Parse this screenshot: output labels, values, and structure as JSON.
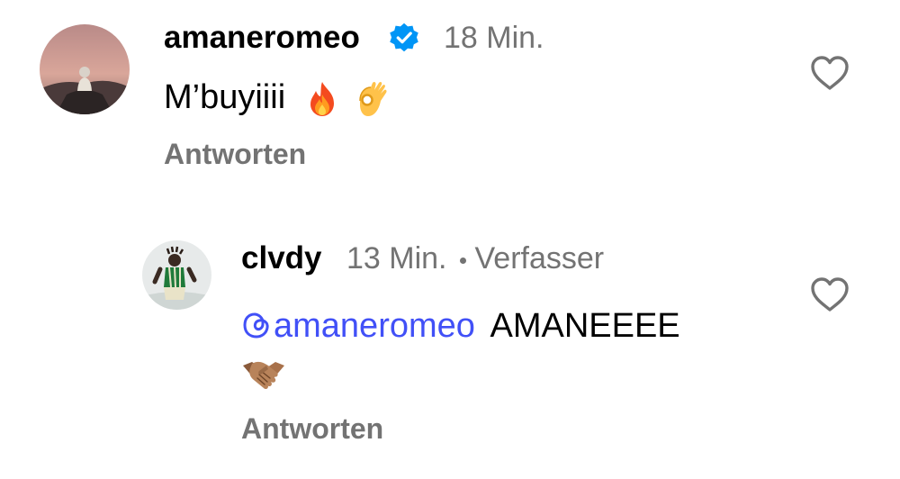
{
  "comment": {
    "username": "amaneromeo",
    "verified": true,
    "time": "18 Min.",
    "text": "M’buyiiii",
    "emojis": [
      "fire-emoji",
      "ok-hand-emoji"
    ],
    "reply_label": "Antworten",
    "like_icon": "heart-outline-icon"
  },
  "reply": {
    "username": "clvdy",
    "time": "13 Min.",
    "author_label": "Verfasser",
    "mention": "amaneromeo",
    "text": "AMANEEEE",
    "emojis": [
      "handshake-emoji"
    ],
    "reply_label": "Antworten",
    "like_icon": "heart-outline-icon"
  },
  "colors": {
    "primary_text": "#000000",
    "secondary_text": "#737373",
    "mention": "#4150f7",
    "verified_badge": "#0095f6"
  }
}
